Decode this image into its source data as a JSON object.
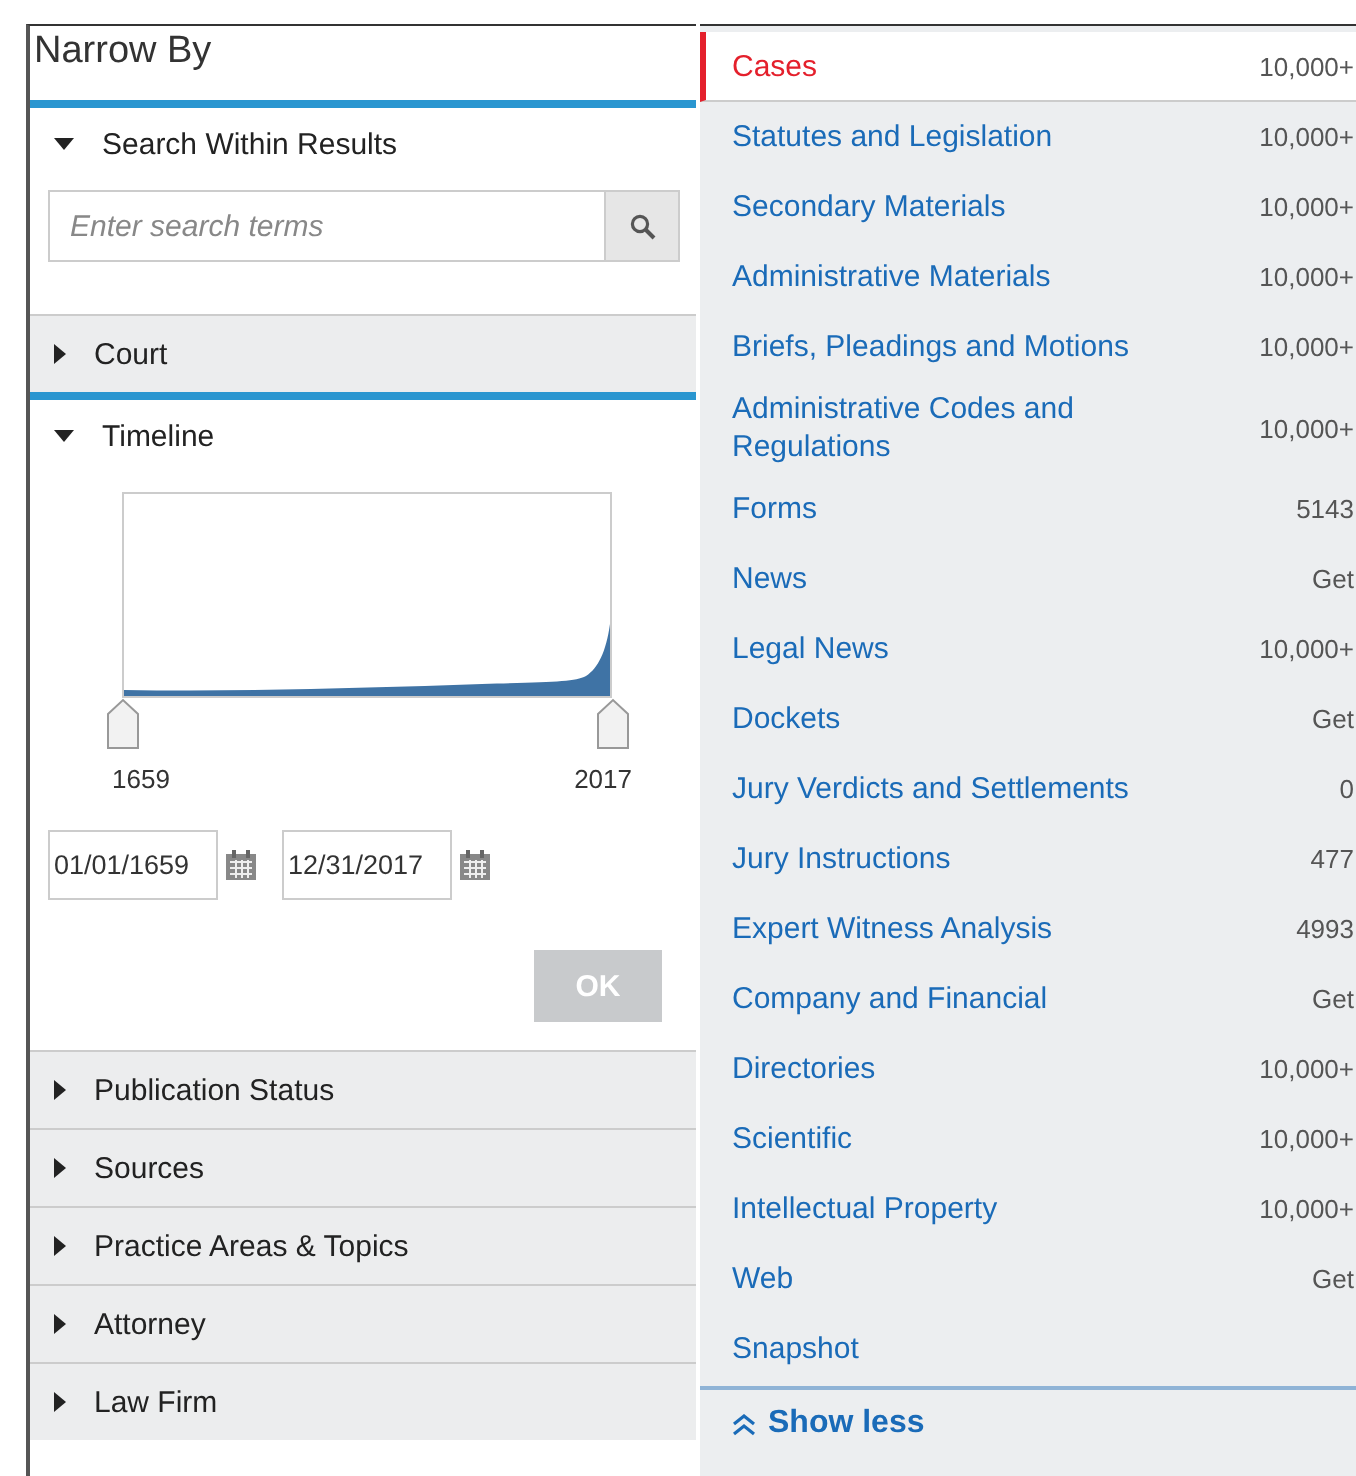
{
  "narrow_by": {
    "title": "Narrow By",
    "sections": [
      {
        "kind": "search",
        "label": "Search Within Results",
        "expanded": true,
        "placeholder": "Enter search terms"
      },
      {
        "label": "Court",
        "expanded": false
      },
      {
        "kind": "timeline",
        "label": "Timeline",
        "expanded": true,
        "range_start": "1659",
        "range_end": "2017",
        "date_from": "01/01/1659",
        "date_to": "12/31/2017",
        "ok_button": {
          "label": "OK",
          "disabled": true
        }
      },
      {
        "label": "Publication Status",
        "expanded": false
      },
      {
        "label": "Sources",
        "expanded": false
      },
      {
        "label": "Practice Areas & Topics",
        "expanded": false
      },
      {
        "label": "Attorney",
        "expanded": false
      },
      {
        "label": "Law Firm",
        "expanded": false
      }
    ]
  },
  "categories": {
    "items": [
      {
        "label": "Cases",
        "count": "10,000+",
        "selected": true
      },
      {
        "label": "Statutes and Legislation",
        "count": "10,000+",
        "selected": false
      },
      {
        "label": "Secondary Materials",
        "count": "10,000+",
        "selected": false
      },
      {
        "label": "Administrative Materials",
        "count": "10,000+",
        "selected": false
      },
      {
        "label": "Briefs, Pleadings and Motions",
        "count": "10,000+",
        "selected": false
      },
      {
        "label": "Administrative Codes and Regulations",
        "count": "10,000+",
        "selected": false
      },
      {
        "label": "Forms",
        "count": "5143",
        "selected": false
      },
      {
        "label": "News",
        "count": "Get",
        "selected": false
      },
      {
        "label": "Legal News",
        "count": "10,000+",
        "selected": false
      },
      {
        "label": "Dockets",
        "count": "Get",
        "selected": false
      },
      {
        "label": "Jury Verdicts and Settlements",
        "count": "0",
        "selected": false
      },
      {
        "label": "Jury Instructions",
        "count": "477",
        "selected": false
      },
      {
        "label": "Expert Witness Analysis",
        "count": "4993",
        "selected": false
      },
      {
        "label": "Company and Financial",
        "count": "Get",
        "selected": false
      },
      {
        "label": "Directories",
        "count": "10,000+",
        "selected": false
      },
      {
        "label": "Scientific",
        "count": "10,000+",
        "selected": false
      },
      {
        "label": "Intellectual Property",
        "count": "10,000+",
        "selected": false
      },
      {
        "label": "Web",
        "count": "Get",
        "selected": false
      },
      {
        "label": "Snapshot",
        "selected": false
      }
    ],
    "show_less": "Show less"
  }
}
